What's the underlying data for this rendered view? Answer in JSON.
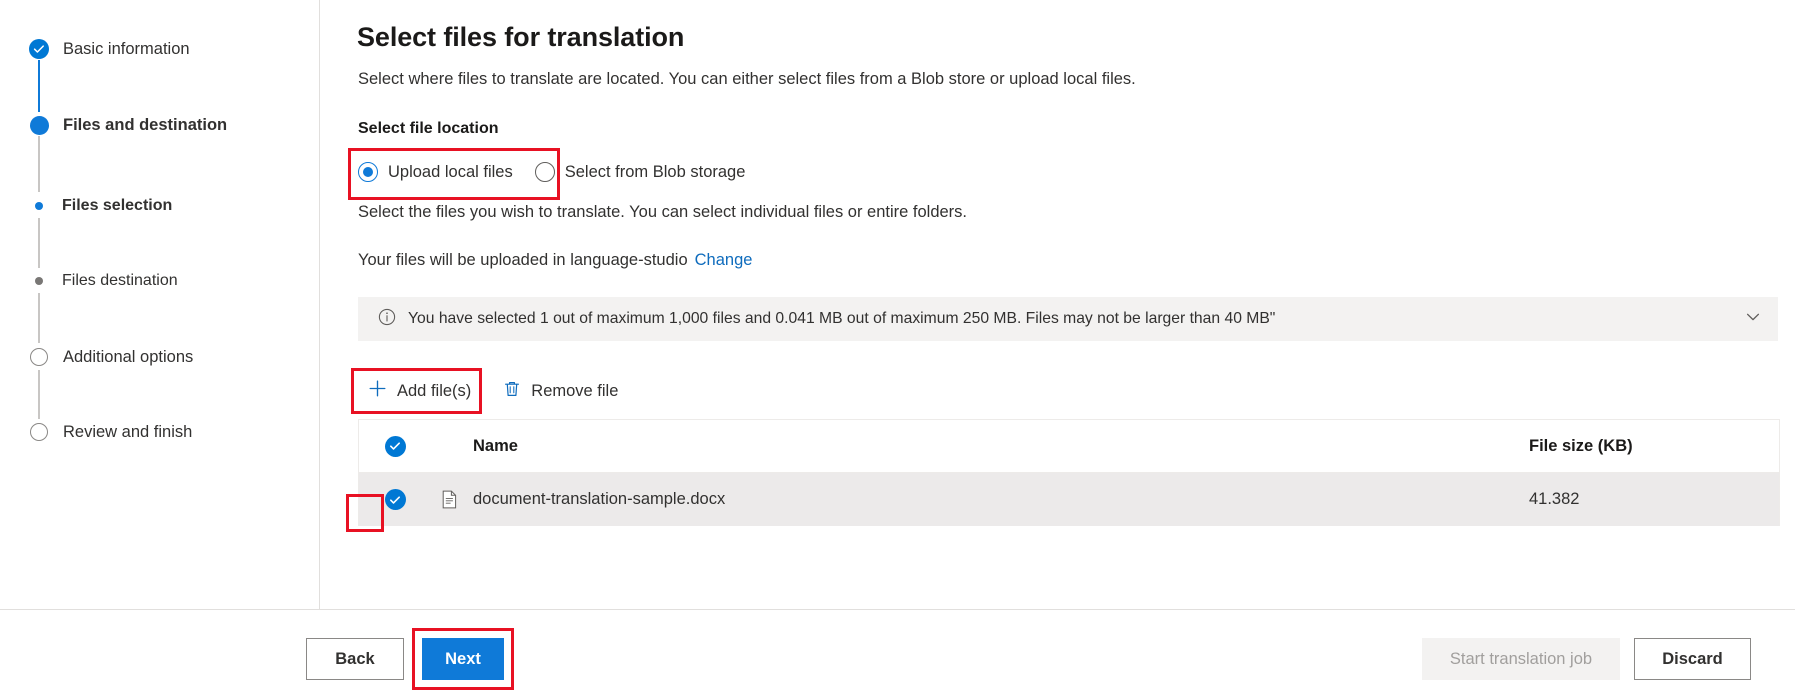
{
  "wizard": {
    "steps": [
      {
        "label": "Basic information",
        "state": "completed",
        "marker": "check-circle-icon"
      },
      {
        "label": "Files and destination",
        "state": "current",
        "marker": "filled-circle-icon"
      },
      {
        "label": "Files selection",
        "state": "active-substep",
        "marker": "small-dot-icon"
      },
      {
        "label": "Files destination",
        "state": "substep",
        "marker": "small-dot-icon"
      },
      {
        "label": "Additional options",
        "state": "upcoming",
        "marker": "empty-circle-icon"
      },
      {
        "label": "Review and finish",
        "state": "upcoming",
        "marker": "empty-circle-icon"
      }
    ]
  },
  "main": {
    "title": "Select files for translation",
    "description": "Select where files to translate are located. You can either select files from a Blob store or upload local files.",
    "file_location_label": "Select file location",
    "radios": [
      {
        "label": "Upload local files",
        "selected": true
      },
      {
        "label": "Select from Blob storage",
        "selected": false
      }
    ],
    "files_hint": "Select the files you wish to translate. You can select individual files or entire folders.",
    "upload_location_text": "Your files will be uploaded in language-studio",
    "change_link": "Change",
    "info_banner": {
      "icon": "info-icon",
      "text": "You have selected 1 out of maximum 1,000 files and 0.041 MB out of maximum 250 MB. Files may not be larger than 40 MB\"",
      "expand_icon": "chevron-down-icon"
    },
    "commands": [
      {
        "label": "Add file(s)",
        "icon": "plus-icon"
      },
      {
        "label": "Remove file",
        "icon": "trash-icon"
      }
    ],
    "table": {
      "columns": [
        "Name",
        "File size (KB)"
      ],
      "header_select_all": true,
      "rows": [
        {
          "selected": true,
          "icon": "document-icon",
          "name": "document-translation-sample.docx",
          "size": "41.382"
        }
      ]
    }
  },
  "footer": {
    "back": "Back",
    "next": "Next",
    "start": "Start translation job",
    "discard": "Discard"
  },
  "colors": {
    "accent_blue": "#0f7ad8",
    "check_blue": "#0078d4",
    "link_blue": "#0f6cbd",
    "highlight_red": "#e81123",
    "banner_bg": "#f3f2f1",
    "row_bg": "#eceaea"
  }
}
